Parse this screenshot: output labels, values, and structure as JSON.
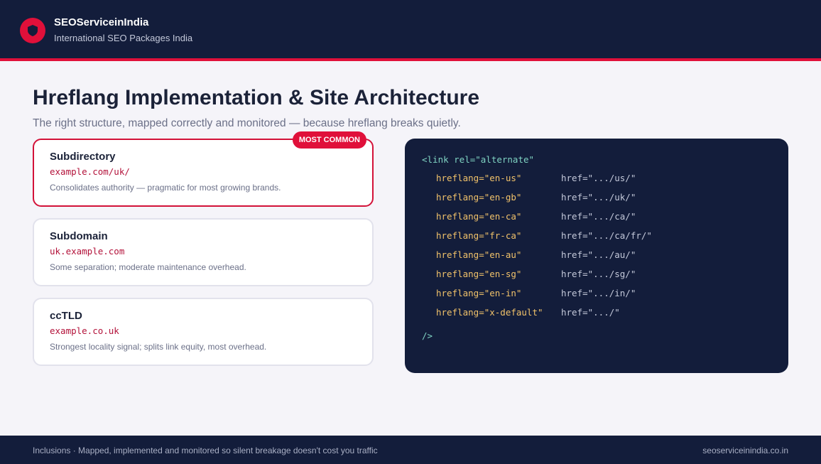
{
  "header": {
    "brand_name": "SEOServiceinIndia",
    "tagline": "International SEO Packages India",
    "logo_icon": "shield-icon",
    "accent_color": "#e0103a",
    "bg_color": "#131d3b"
  },
  "main": {
    "title": "Hreflang Implementation & Site Architecture",
    "subtitle": "The right structure, mapped correctly and monitored — because hreflang breaks quietly."
  },
  "cards": [
    {
      "title": "Subdirectory",
      "url": "example.com/uk/",
      "description": "Consolidates authority — pragmatic for most growing brands.",
      "badge": "MOST COMMON"
    },
    {
      "title": "Subdomain",
      "url": "uk.example.com",
      "description": "Some separation; moderate maintenance overhead."
    },
    {
      "title": "ccTLD",
      "url": "example.co.uk",
      "description": "Strongest locality signal; splits link equity, most overhead."
    }
  ],
  "code": {
    "open_tag": "<link rel=\"alternate\"",
    "rows": [
      {
        "hreflang": "hreflang=\"en-us\"",
        "href": "href=\".../us/\""
      },
      {
        "hreflang": "hreflang=\"en-gb\"",
        "href": "href=\".../uk/\""
      },
      {
        "hreflang": "hreflang=\"en-ca\"",
        "href": "href=\".../ca/\""
      },
      {
        "hreflang": "hreflang=\"fr-ca\"",
        "href": "href=\".../ca/fr/\""
      },
      {
        "hreflang": "hreflang=\"en-au\"",
        "href": "href=\".../au/\""
      },
      {
        "hreflang": "hreflang=\"en-sg\"",
        "href": "href=\".../sg/\""
      },
      {
        "hreflang": "hreflang=\"en-in\"",
        "href": "href=\".../in/\""
      },
      {
        "hreflang": "hreflang=\"x-default\"",
        "href": "href=\".../\""
      }
    ],
    "close_tag": "/>"
  },
  "footer": {
    "left": "Inclusions · Mapped, implemented and monitored so silent breakage doesn't cost you traffic",
    "right": "seoserviceinindia.co.in"
  }
}
